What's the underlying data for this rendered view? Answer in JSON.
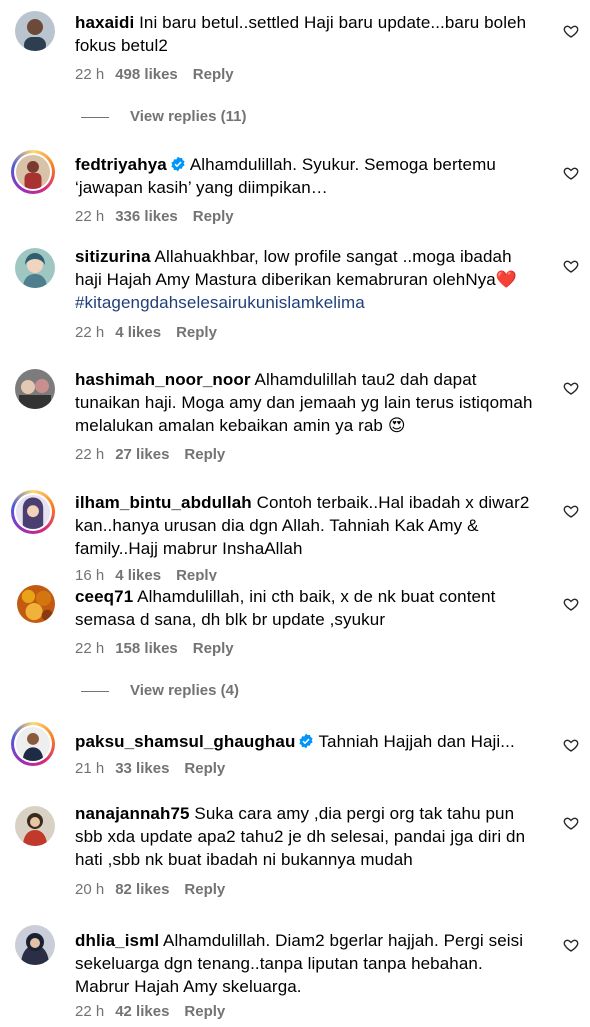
{
  "comments": [
    {
      "user": "haxaidi",
      "verified": false,
      "text": "Ini baru betul..settled Haji baru update...baru boleh fokus betul2",
      "time": "22 h",
      "likes": "498 likes",
      "reply": "Reply",
      "view_replies": "View replies (11)"
    },
    {
      "user": "fedtriyahya",
      "verified": true,
      "text": "Alhamdulillah. Syukur. Semoga bertemu ‘jawapan kasih’ yang diimpikan…",
      "time": "22 h",
      "likes": "336 likes",
      "reply": "Reply"
    },
    {
      "user": "sitizurina",
      "verified": false,
      "text": "Allahuakhbar, low profile sangat ..moga ibadah haji Hajah Amy Mastura diberikan kemabruran olehNya",
      "emoji": "❤️",
      "hashtag": "#kitagengdahselesairukunislamkelima",
      "time": "22 h",
      "likes": "4 likes",
      "reply": "Reply"
    },
    {
      "user": "hashimah_noor_noor",
      "verified": false,
      "text": "Alhamdulillah tau2 dah dapat tunaikan haji. Moga amy dan jemaah yg lain terus istiqomah melalukan amalan kebaikan amin ya rab",
      "emoji": "😍",
      "time": "22 h",
      "likes": "27 likes",
      "reply": "Reply"
    },
    {
      "user": "ilham_bintu_abdullah",
      "verified": false,
      "text": "Contoh terbaik..Hal ibadah x diwar2 kan..hanya urusan dia dgn Allah. Tahniah Kak Amy & family..Hajj mabrur InshaAllah",
      "time": "16 h",
      "likes": "4 likes",
      "reply": "Reply"
    },
    {
      "user": "ceeq71",
      "verified": false,
      "text": "Alhamdulillah, ini cth baik, x de nk buat content semasa d sana, dh blk br update ,syukur",
      "time": "22 h",
      "likes": "158 likes",
      "reply": "Reply",
      "view_replies": "View replies (4)"
    },
    {
      "user": "paksu_shamsul_ghaughau",
      "verified": true,
      "text": "Tahniah Hajjah dan Haji...",
      "time": "21 h",
      "likes": "33 likes",
      "reply": "Reply"
    },
    {
      "user": "nanajannah75",
      "verified": false,
      "text": "Suka cara amy ,dia pergi org tak tahu pun sbb xda update apa2 tahu2 je dh selesai, pandai jga diri dn hati ,sbb nk buat ibadah ni bukannya mudah",
      "time": "20 h",
      "likes": "82 likes",
      "reply": "Reply"
    },
    {
      "user": "dhlia_isml",
      "verified": false,
      "text": "Alhamdulillah. Diam2 bgerlar hajjah. Pergi seisi sekeluarga dgn tenang..tanpa liputan tanpa hebahan. Mabrur Hajah Amy skeluarga.",
      "time": "22 h",
      "likes": "42 likes",
      "reply": "Reply"
    }
  ],
  "colors": {
    "meta": "#737373",
    "hashtag": "#1f3f7a",
    "verified": "#0095f6"
  },
  "icons": {
    "like": "heart-outline-icon",
    "verified": "verified-badge-icon"
  }
}
